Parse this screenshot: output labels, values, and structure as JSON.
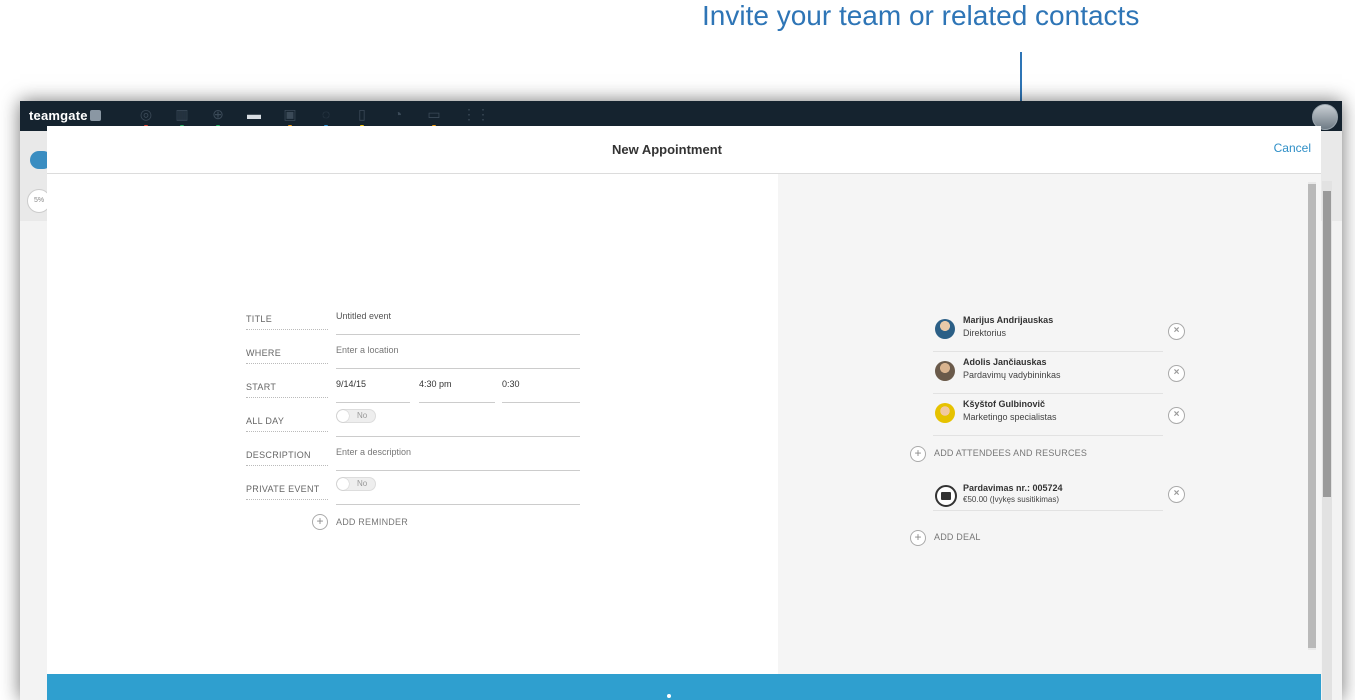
{
  "callout": {
    "text": "Invite your team or related contacts",
    "color": "#2e75b6"
  },
  "app": {
    "logo": "teamgate",
    "nav_icons": [
      "target-icon",
      "columns-icon",
      "globe-icon",
      "briefcase-icon",
      "calendar-icon",
      "chat-icon",
      "clipboard-icon",
      "pie-chart-icon",
      "card-icon",
      "grid-icon"
    ],
    "nav_dot_colors": [
      "#e74c3c",
      "#27ae60",
      "#27ae60",
      "#8e44ad",
      "#f39c12",
      "#3498db",
      "#f1c40f",
      "#2ecc71",
      "#f39c12"
    ],
    "background_badge": "5%"
  },
  "modal": {
    "title": "New Appointment",
    "cancel_label": "Cancel"
  },
  "form": {
    "title_label": "TITLE",
    "title_value": "Untitled event",
    "where_label": "WHERE",
    "where_placeholder": "Enter a location",
    "start_label": "START",
    "start_date": "9/14/15",
    "start_time": "4:30 pm",
    "start_duration": "0:30",
    "all_day_label": "ALL DAY",
    "all_day_value": "No",
    "description_label": "DESCRIPTION",
    "description_placeholder": "Enter a description",
    "private_label": "PRIVATE EVENT",
    "private_value": "No",
    "add_reminder": "ADD REMINDER"
  },
  "attendees": [
    {
      "name": "Marijus Andrijauskas",
      "role": "Direktorius"
    },
    {
      "name": "Adolis Jančiauskas",
      "role": "Pardavimų vadybininkas"
    },
    {
      "name": "Kšyštof Gulbinovič",
      "role": "Marketingo specialistas"
    }
  ],
  "add_attendees": "ADD ATTENDEES AND RESURCES",
  "deal": {
    "name": "Pardavimas nr.: 005724",
    "detail": "€50.00 (Įvykęs susitikimas)"
  },
  "add_deal": "ADD DEAL",
  "colors": {
    "accent": "#2f9fcf",
    "topbar": "#15232f"
  }
}
